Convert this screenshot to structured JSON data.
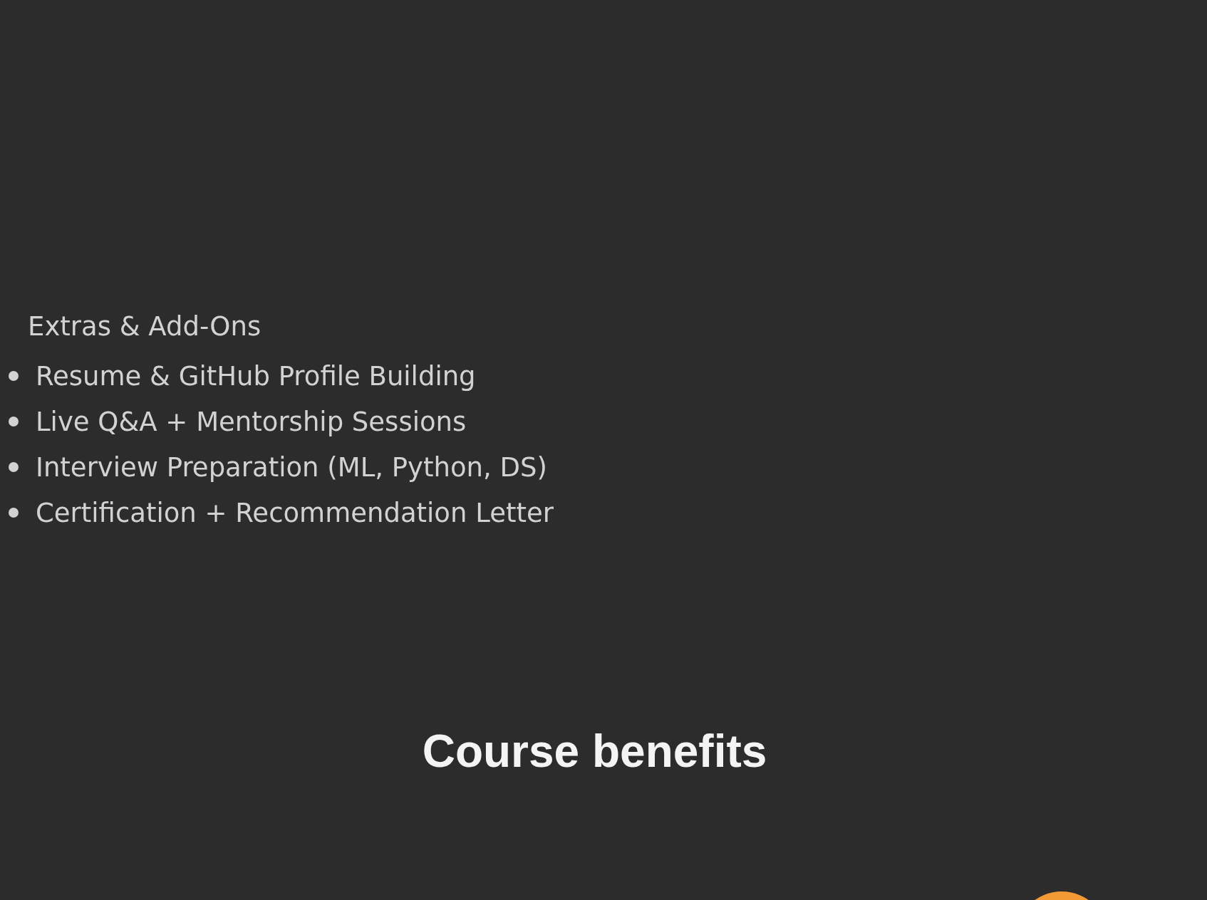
{
  "extras": {
    "title": "Extras & Add-Ons",
    "items": [
      "Resume & GitHub Profile Building",
      "Live Q&A + Mentorship Sessions",
      "Interview Preparation (ML, Python, DS)",
      "Certification + Recommendation Letter"
    ]
  },
  "benefits": {
    "title": "Course benefits"
  }
}
